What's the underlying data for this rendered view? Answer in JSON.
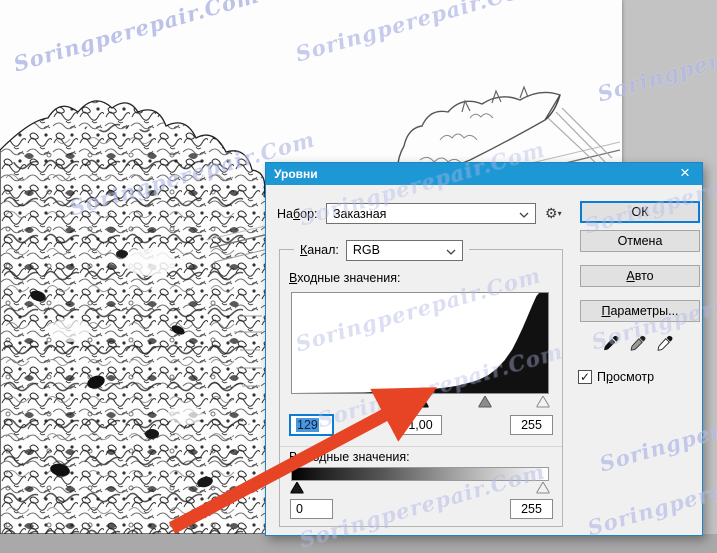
{
  "watermark": {
    "text": "Soringperepair.Com"
  },
  "icons": {
    "gear": "⚙",
    "gear_arrow": "▾",
    "checkmark": "✓",
    "close": "×"
  },
  "colors": {
    "titlebar": "#1e97d5",
    "ok_border": "#0c7bd3",
    "arrow": "#e64425",
    "selection": "#4a97de"
  },
  "dialog": {
    "title": "Уровни",
    "preset_row": {
      "label_pre": "На",
      "label_key": "б",
      "label_post": "ор:",
      "value": "Заказная"
    },
    "channel_row": {
      "label_key": "К",
      "label_post": "анал:",
      "value": "RGB"
    },
    "input_section": {
      "label_key": "В",
      "label_post": "ходные значения:",
      "black_value": "129",
      "gamma_value": "1,00",
      "white_value": "255"
    },
    "output_section": {
      "label_pre": "В",
      "label_key": "ы",
      "label_post": "ходные значения:",
      "black_value": "0",
      "white_value": "255"
    },
    "buttons": {
      "ok": "ОК",
      "cancel": "Отмена",
      "auto_key": "А",
      "auto_post": "вто",
      "options_key": "П",
      "options_post": "араметры..."
    },
    "preview_checkbox": {
      "label_pre": "П",
      "label_key": "р",
      "label_post": "осмотр",
      "checked": true
    },
    "histogram": {
      "type": "area",
      "input_levels": {
        "black": 129,
        "gamma": 1.0,
        "white": 255
      },
      "output_levels": {
        "black": 0,
        "white": 255
      },
      "points": [
        [
          0,
          0
        ],
        [
          0.28,
          0.005
        ],
        [
          0.34,
          0.012
        ],
        [
          0.4,
          0.018
        ],
        [
          0.44,
          0.022
        ],
        [
          0.48,
          0.028
        ],
        [
          0.52,
          0.034
        ],
        [
          0.56,
          0.042
        ],
        [
          0.6,
          0.055
        ],
        [
          0.64,
          0.07
        ],
        [
          0.68,
          0.095
        ],
        [
          0.71,
          0.115
        ],
        [
          0.74,
          0.145
        ],
        [
          0.77,
          0.185
        ],
        [
          0.8,
          0.245
        ],
        [
          0.83,
          0.325
        ],
        [
          0.86,
          0.435
        ],
        [
          0.88,
          0.535
        ],
        [
          0.9,
          0.645
        ],
        [
          0.92,
          0.765
        ],
        [
          0.94,
          0.885
        ],
        [
          0.955,
          0.97
        ],
        [
          0.965,
          1
        ],
        [
          1,
          1
        ]
      ]
    }
  }
}
